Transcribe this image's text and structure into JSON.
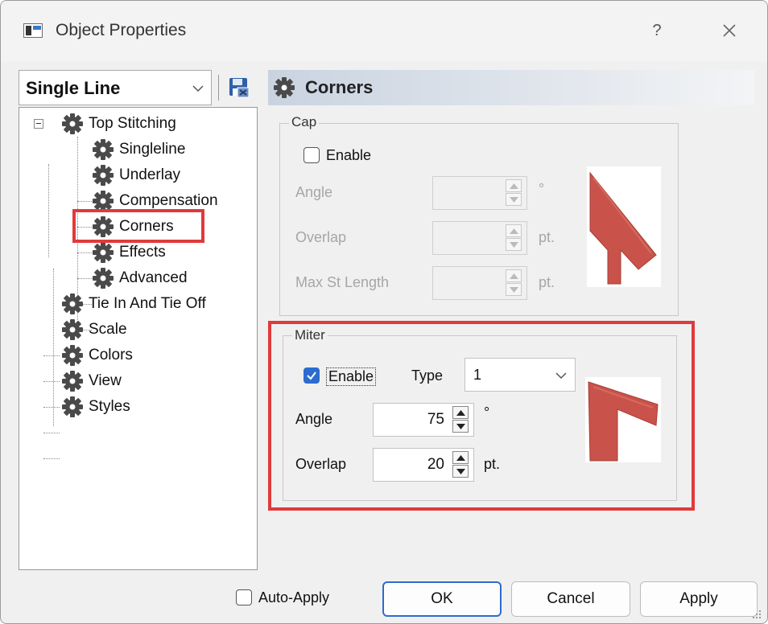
{
  "window": {
    "title": "Object Properties",
    "help": "?"
  },
  "left": {
    "combo_value": "Single Line",
    "tree": [
      {
        "label": "Top Stitching"
      },
      {
        "label": "Singleline"
      },
      {
        "label": "Underlay"
      },
      {
        "label": "Compensation"
      },
      {
        "label": "Corners"
      },
      {
        "label": "Effects"
      },
      {
        "label": "Advanced"
      },
      {
        "label": "Tie In And Tie Off"
      },
      {
        "label": "Scale"
      },
      {
        "label": "Colors"
      },
      {
        "label": "View"
      },
      {
        "label": "Styles"
      }
    ],
    "selected": "Corners"
  },
  "right": {
    "header_title": "Corners",
    "cap": {
      "group_label": "Cap",
      "enable_label": "Enable",
      "enable_checked": false,
      "angle_label": "Angle",
      "angle_value": "",
      "angle_unit": "°",
      "overlap_label": "Overlap",
      "overlap_value": "",
      "overlap_unit": "pt.",
      "max_label": "Max St Length",
      "max_value": "",
      "max_unit": "pt."
    },
    "miter": {
      "group_label": "Miter",
      "enable_label": "Enable",
      "enable_checked": true,
      "type_label": "Type",
      "type_value": "1",
      "angle_label": "Angle",
      "angle_value": "75",
      "angle_unit": "°",
      "overlap_label": "Overlap",
      "overlap_value": "20",
      "overlap_unit": "pt."
    }
  },
  "footer": {
    "auto_apply_label": "Auto-Apply",
    "auto_apply_checked": false,
    "ok": "OK",
    "cancel": "Cancel",
    "apply": "Apply"
  },
  "colors": {
    "highlight": "#e03a3a",
    "accent": "#2d6ccf",
    "preview": "#c9534a"
  },
  "icons": [
    "app-icon",
    "help-icon",
    "close-icon",
    "chevron-down-icon",
    "save-icon",
    "gear-icon",
    "spin-up-icon",
    "spin-down-icon",
    "resize-grip-icon"
  ]
}
